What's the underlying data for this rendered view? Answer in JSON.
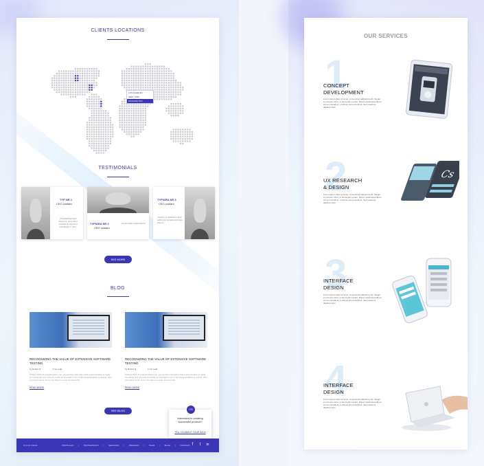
{
  "left": {
    "clients": {
      "title": "CLIENTS LOCATIONS"
    },
    "tooltip": {
      "items": [
        "LOS ANGELES",
        "NEW YORK",
        "WASHINGTON"
      ],
      "selected": 2
    },
    "testimonials": {
      "title": "TESTIMONIALS",
      "cards": [
        {
          "name": "TYP NR 1",
          "role": "CEO costam",
          "quote": "„Przykładowy tekst referencji, który klient zostawił po wspólnej współpracy z nami"
        },
        {
          "name": "TYPIARA NR 2",
          "role": "CEO costam",
          "quote": "„Krótki cytat z opinii klienta"
        },
        {
          "name": "TYPIARA NR 3",
          "role": "CEO costam",
          "quote": "„Kolejny przykładowy tekst referencji od zadowolonego klienta"
        }
      ],
      "see_more": "SEE MORE"
    },
    "blog": {
      "title": "BLOG",
      "posts": [
        {
          "title": "RECOGNIZING THE VALUE OF EXTENSIVE SOFTWARE TESTING",
          "author": "by Robert Q.",
          "time": "7 min read",
          "excerpt": "Today's Wi-Fi IT projects warns you, you get the information that a given feature is ready for testing and you write it's works as intended or not. If the implementation is correct, then your job is done. If not, you have to report an issue first.",
          "more": "READ MORE"
        },
        {
          "title": "RECOGNIZING THE VALUE OF EXTENSIVE SOFTWARE TESTING",
          "author": "by Robert Q.",
          "time": "7 min read",
          "excerpt": "Today's Wi-Fi IT projects warns you, you get the information that a given feature is ready for testing and you write it's works as intended or not. If the implementation is correct, then your job is done. If not, you have to report an issue first.",
          "more": "READ MORE"
        }
      ],
      "see_blog": "SEE BLOG"
    },
    "popup": {
      "badge": "CS",
      "question": "Interested in creating successful product?",
      "link": "TELL US ABOUT YOUR IDEA!"
    },
    "footer": {
      "copyright": "10 is ⊕ Ordinal",
      "nav": [
        "PORTFOLIO",
        "|",
        "TESTIMONIALS",
        "|",
        "SERVICES",
        "|",
        "PROCESS",
        "|",
        "TEAM",
        "|",
        "BLOG",
        "|",
        "CONTACT"
      ],
      "social": [
        "f",
        "t",
        "in"
      ]
    }
  },
  "right": {
    "title": "OUR SERVICES",
    "services": [
      {
        "number": "1",
        "title_line1": "CONCEPT",
        "title_line2": "DEVELOPMENT",
        "desc": "Lorem ipsum dolor sit amet, consectetur adipiscing elit. Integer et posuere tortor, ut elementum quam. Donec scelerisque libero vel sem tincidunt, a ultrices purus tincidunt. Sed maximus dapibus risus.",
        "device": "tablet-icon"
      },
      {
        "number": "2",
        "title_line1": "UX RESEARCH",
        "title_line2": "& DESIGN",
        "desc": "Lorem ipsum dolor sit amet, consectetur adipiscing elit. Integer et posuere tortor, ut elementum quam. Donec scelerisque libero vel sem tincidunt, a ultrices purus tincidunt. Sed maximus dapibus risus.",
        "device": "phone-mockup-icon"
      },
      {
        "number": "3",
        "title_line1": "INTERFACE",
        "title_line2": "DESIGN",
        "desc": "Lorem ipsum dolor sit amet, consectetur adipiscing elit. Integer et posuere tortor, ut elementum quam. Donec scelerisque libero vel sem tincidunt, a ultrices purus tincidunt. Sed maximus dapibus risus.",
        "device": "phones-icon"
      },
      {
        "number": "4",
        "title_line1": "INTERFACE",
        "title_line2": "DESIGN",
        "desc": "Lorem ipsum dolor sit amet, consectetur adipiscing elit. Integer et posuere tortor, ut elementum quam. Donec scelerisque libero vel sem tincidunt, a ultrices purus tincidunt. Sed maximus dapibus risus.",
        "device": "laptop-icon"
      }
    ]
  },
  "colors": {
    "accent": "#3b35b8",
    "map_dot": "#c9c9d2",
    "map_highlight": "#3b35b8",
    "number_tint": "#dcecf8"
  }
}
